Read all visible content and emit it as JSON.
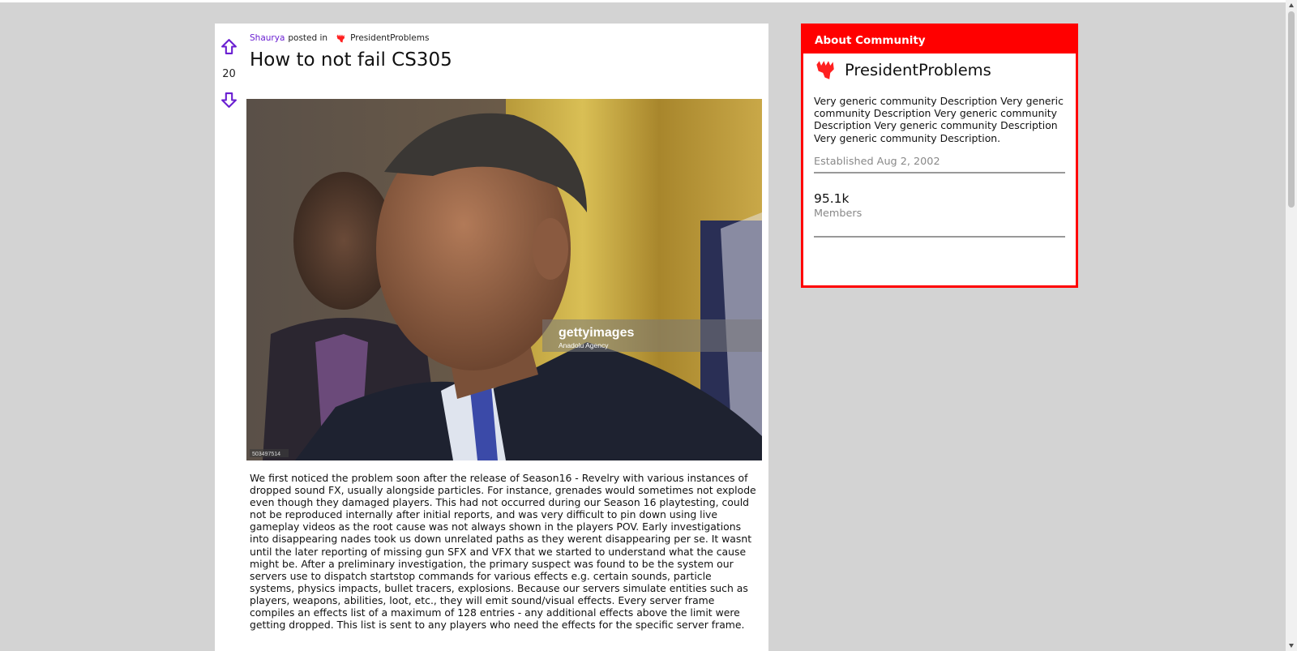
{
  "post": {
    "author": "Shaurya",
    "posted_in_text": "posted in",
    "community": "PresidentProblems",
    "title": "How to not fail CS305",
    "vote_count": "20",
    "image": {
      "watermark_brand": "gettyimages",
      "watermark_credit": "Anadolu Agency",
      "image_id_tag": "503497514"
    },
    "body": "We first noticed the problem soon after the release of Season16 - Revelry with various instances of dropped sound FX, usually alongside particles. For instance, grenades would sometimes not explode even though they damaged players. This had not occurred during our Season 16 playtesting, could not be reproduced internally after initial reports, and was very difficult to pin down using live gameplay videos as the root cause was not always shown in the players POV. Early investigations into disappearing nades took us down unrelated paths as they werent disappearing per se. It wasnt until the later reporting of missing gun SFX and VFX that we started to understand what the cause might be. After a preliminary investigation, the primary suspect was found to be the system our servers use to dispatch startstop commands for various effects e.g. certain sounds, particle systems, physics impacts, bullet tracers, explosions. Because our servers simulate entities such as players, weapons, abilities, loot, etc., they will emit sound/visual effects. Every server frame compiles an effects list of a maximum of 128 entries - any additional effects above the limit were getting dropped. This list is sent to any players who need the effects for the specific server frame."
  },
  "sidebar": {
    "header": "About Community",
    "community_name": "PresidentProblems",
    "description": "Very generic community Description Very generic community Description Very generic community Description Very generic community Description Very generic community Description.",
    "established": "Established Aug 2, 2002",
    "members_count": "95.1k",
    "members_label": "Members"
  },
  "icons": {
    "upvote": "arrow-up-icon",
    "downvote": "arrow-down-icon",
    "community": "fist-logo-icon"
  },
  "colors": {
    "accent_red": "#ff0000",
    "author_purple": "#6a1fd1",
    "page_bg": "#d3d3d3"
  }
}
